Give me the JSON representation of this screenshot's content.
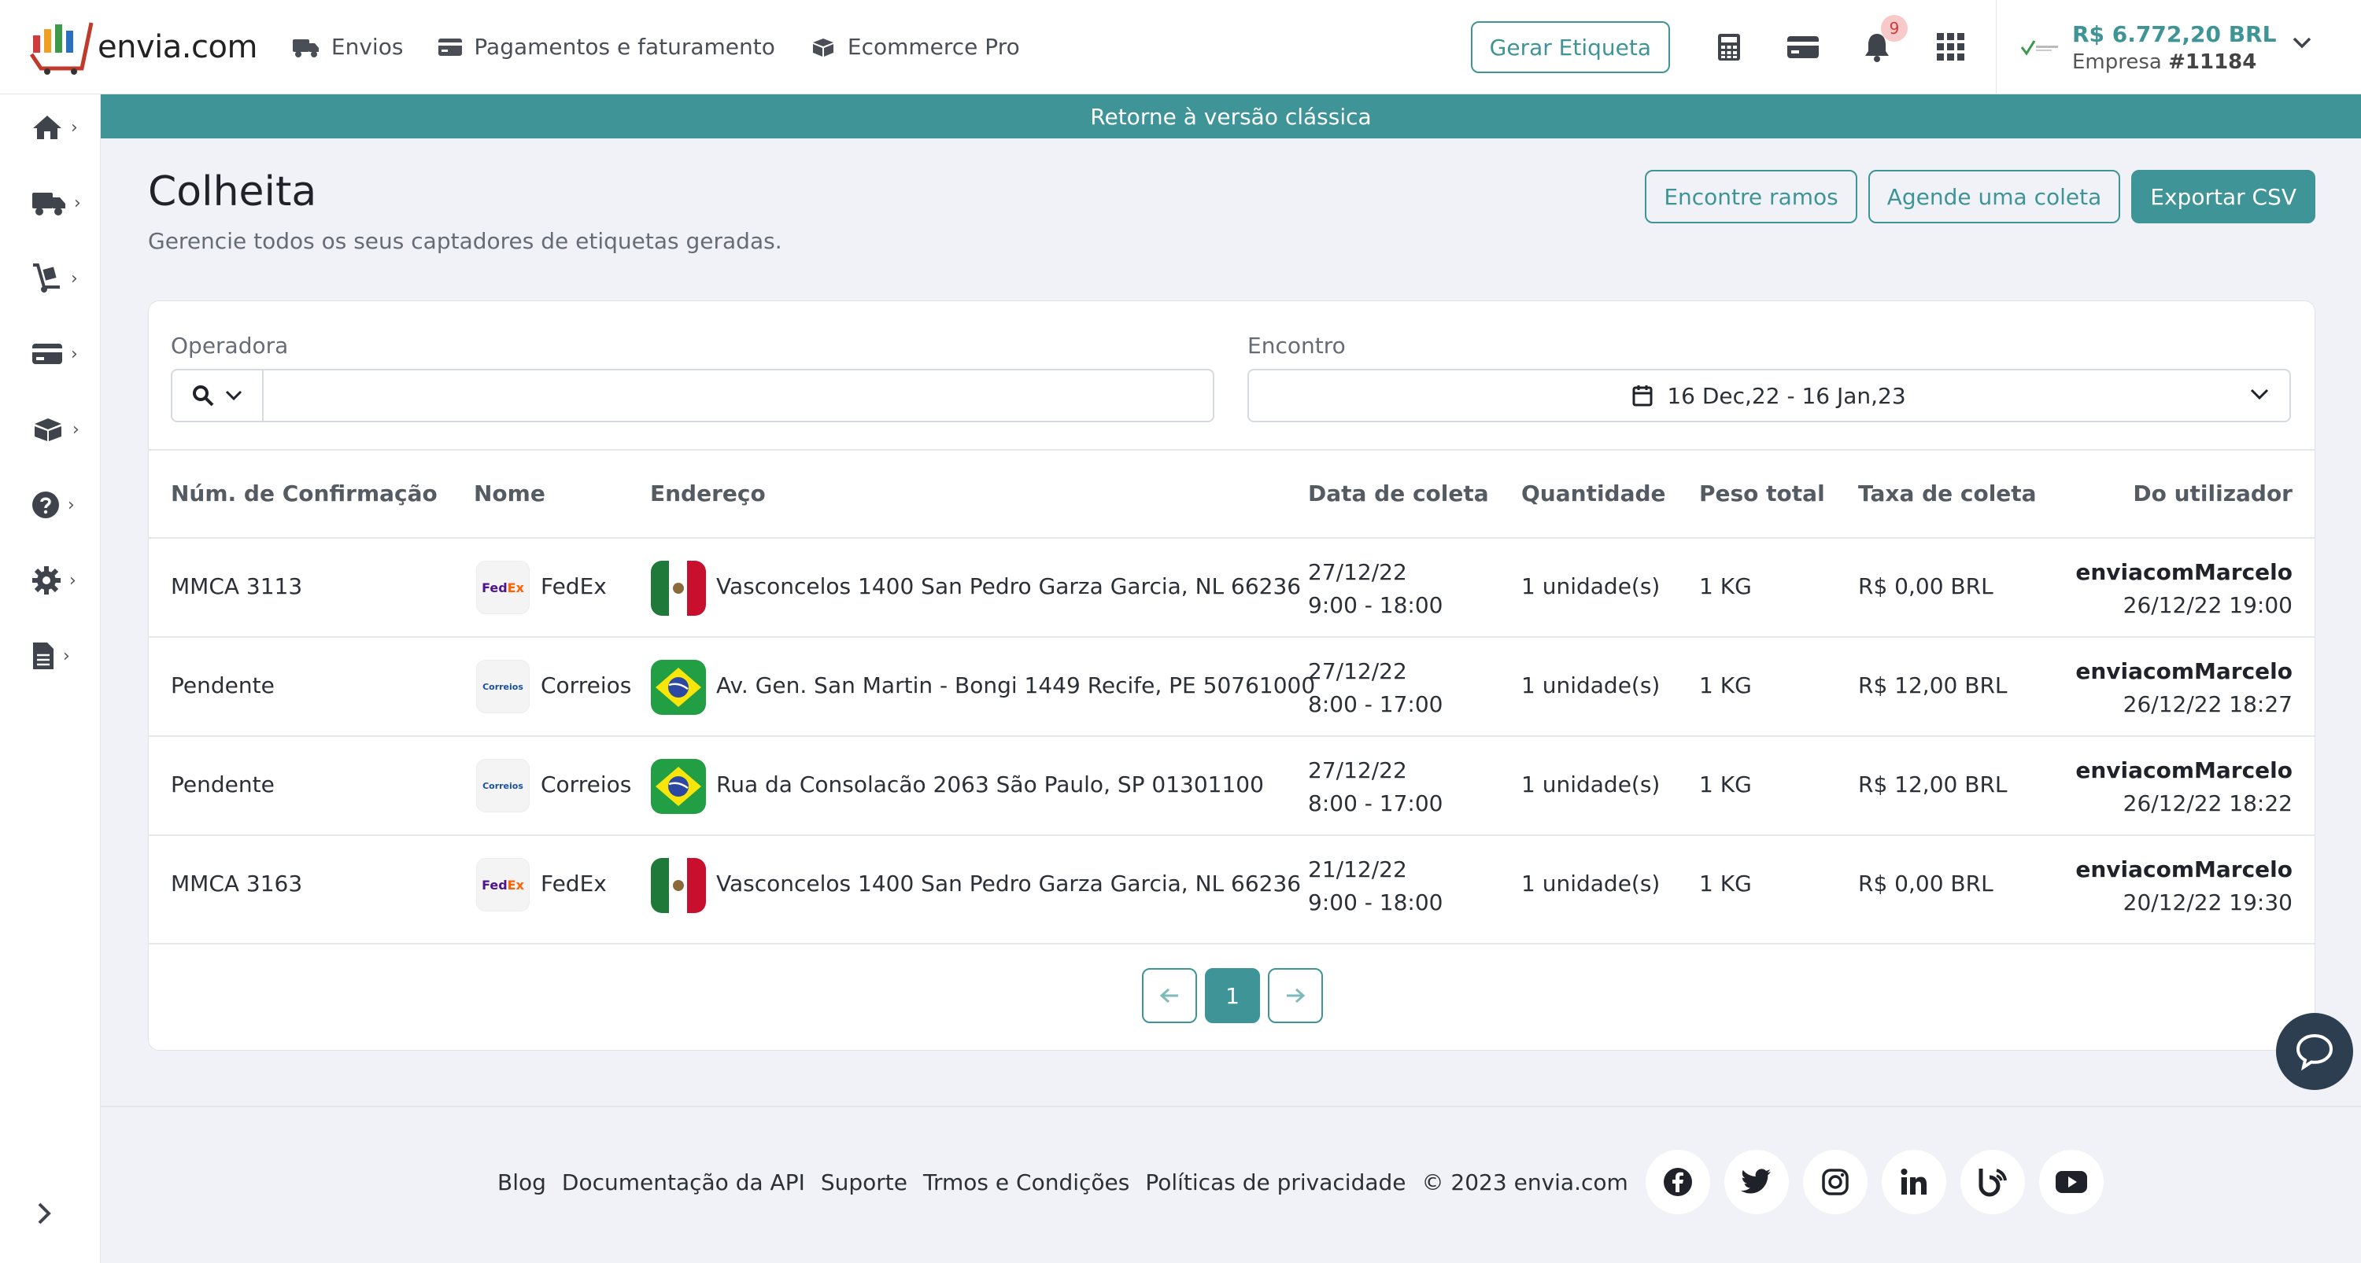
{
  "brand": {
    "name": "envia.com"
  },
  "topnav": [
    {
      "label": "Envios"
    },
    {
      "label": "Pagamentos e faturamento"
    },
    {
      "label": "Ecommerce Pro"
    }
  ],
  "header_actions": {
    "generate_label": "Gerar Etiqueta",
    "notifications_count": "9"
  },
  "account": {
    "balance": "R$ 6.772,20 BRL",
    "company_prefix": "Empresa ",
    "company_id": "#11184"
  },
  "banner": {
    "text": "Retorne à versão clássica"
  },
  "page": {
    "title": "Colheita",
    "subtitle": "Gerencie todos os seus captadores de etiquetas geradas.",
    "actions": {
      "find_branches": "Encontre ramos",
      "schedule_pickup": "Agende uma coleta",
      "export_csv": "Exportar CSV"
    }
  },
  "filters": {
    "carrier_label": "Operadora",
    "carrier_value": "",
    "date_label": "Encontro",
    "date_value": "16 Dec,22 - 16 Jan,23"
  },
  "table": {
    "columns": [
      "Núm. de Confirmação",
      "Nome",
      "Endereço",
      "Data de coleta",
      "Quantidade",
      "Peso total",
      "Taxa de coleta",
      "Do utilizador"
    ],
    "rows": [
      {
        "confirmation": "MMCA 3113",
        "carrier": "FedEx",
        "flag": "mx",
        "address": "Vasconcelos 1400 San Pedro Garza Garcia, NL 66236",
        "pickup_date": "27/12/22",
        "pickup_window": "9:00 - 18:00",
        "quantity": "1 unidade(s)",
        "weight": "1 KG",
        "fee": "R$ 0,00 BRL",
        "user": "enviacomMarcelo",
        "created": "26/12/22 19:00"
      },
      {
        "confirmation": "Pendente",
        "carrier": "Correios",
        "flag": "br",
        "address": "Av. Gen. San Martin - Bongi 1449 Recife, PE 50761000",
        "pickup_date": "27/12/22",
        "pickup_window": "8:00 - 17:00",
        "quantity": "1 unidade(s)",
        "weight": "1 KG",
        "fee": "R$ 12,00 BRL",
        "user": "enviacomMarcelo",
        "created": "26/12/22 18:27"
      },
      {
        "confirmation": "Pendente",
        "carrier": "Correios",
        "flag": "br",
        "address": "Rua da Consolacão 2063 São Paulo, SP 01301100",
        "pickup_date": "27/12/22",
        "pickup_window": "8:00 - 17:00",
        "quantity": "1 unidade(s)",
        "weight": "1 KG",
        "fee": "R$ 12,00 BRL",
        "user": "enviacomMarcelo",
        "created": "26/12/22 18:22"
      },
      {
        "confirmation": "MMCA 3163",
        "carrier": "FedEx",
        "flag": "mx",
        "address": "Vasconcelos 1400 San Pedro Garza Garcia, NL 66236",
        "pickup_date": "21/12/22",
        "pickup_window": "9:00 - 18:00",
        "quantity": "1 unidade(s)",
        "weight": "1 KG",
        "fee": "R$ 0,00 BRL",
        "user": "enviacomMarcelo",
        "created": "20/12/22 19:30"
      }
    ]
  },
  "pagination": {
    "current": "1"
  },
  "footer": {
    "links": [
      "Blog",
      "Documentação da API",
      "Suporte",
      "Trmos e Condições",
      "Políticas de privacidade"
    ],
    "copyright": "© 2023 envia.com",
    "social": [
      "facebook-icon",
      "twitter-icon",
      "instagram-icon",
      "linkedin-icon",
      "blog-icon",
      "youtube-icon"
    ]
  },
  "colors": {
    "accent": "#3e9496",
    "banner": "#3e9496",
    "chat": "#2c3e50"
  }
}
